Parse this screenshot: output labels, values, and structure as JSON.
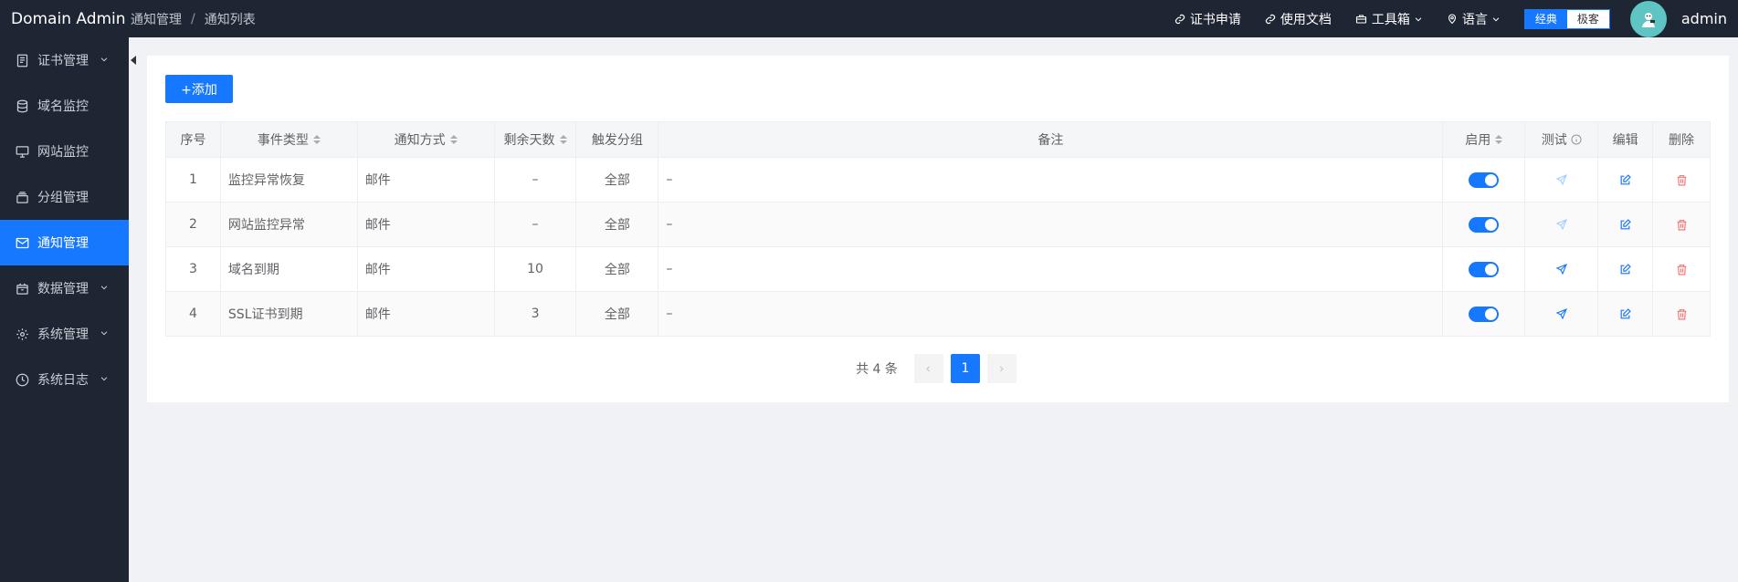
{
  "app": {
    "brand": "Domain Admin"
  },
  "breadcrumb": {
    "first": "通知管理",
    "separator": "/",
    "current": "通知列表"
  },
  "header": {
    "links": {
      "cert_apply": "证书申请",
      "docs": "使用文档",
      "toolbox": "工具箱",
      "language": "语言"
    },
    "mode": {
      "classic": "经典",
      "geek": "极客",
      "selected": "经典"
    },
    "user": {
      "name": "admin"
    }
  },
  "sidebar": {
    "items": [
      {
        "label": "证书管理",
        "icon": "document-icon",
        "expandable": true,
        "active": false
      },
      {
        "label": "域名监控",
        "icon": "database-icon",
        "expandable": false,
        "active": false
      },
      {
        "label": "网站监控",
        "icon": "monitor-icon",
        "expandable": false,
        "active": false
      },
      {
        "label": "分组管理",
        "icon": "stack-icon",
        "expandable": false,
        "active": false
      },
      {
        "label": "通知管理",
        "icon": "mail-icon",
        "expandable": false,
        "active": true
      },
      {
        "label": "数据管理",
        "icon": "box-icon",
        "expandable": true,
        "active": false
      },
      {
        "label": "系统管理",
        "icon": "gear-icon",
        "expandable": true,
        "active": false
      },
      {
        "label": "系统日志",
        "icon": "clock-icon",
        "expandable": true,
        "active": false
      }
    ]
  },
  "toolbar": {
    "add_label": "+添加"
  },
  "table": {
    "columns": {
      "index": "序号",
      "event_type": "事件类型",
      "notify_method": "通知方式",
      "days_left": "剩余天数",
      "trigger_group": "触发分组",
      "remark": "备注",
      "enabled": "启用",
      "test": "测试",
      "edit": "编辑",
      "delete": "删除"
    },
    "rows": [
      {
        "index": "1",
        "event_type": "监控异常恢复",
        "notify_method": "邮件",
        "days_left": "–",
        "trigger_group": "全部",
        "remark": "–",
        "enabled": true,
        "test_enabled": false
      },
      {
        "index": "2",
        "event_type": "网站监控异常",
        "notify_method": "邮件",
        "days_left": "–",
        "trigger_group": "全部",
        "remark": "–",
        "enabled": true,
        "test_enabled": false
      },
      {
        "index": "3",
        "event_type": "域名到期",
        "notify_method": "邮件",
        "days_left": "10",
        "trigger_group": "全部",
        "remark": "–",
        "enabled": true,
        "test_enabled": true
      },
      {
        "index": "4",
        "event_type": "SSL证书到期",
        "notify_method": "邮件",
        "days_left": "3",
        "trigger_group": "全部",
        "remark": "–",
        "enabled": true,
        "test_enabled": true
      }
    ]
  },
  "pagination": {
    "total_text": "共 4 条",
    "current_page": "1"
  },
  "colors": {
    "primary": "#1677ff",
    "sidebar_bg": "#1f2633",
    "delete": "#f56c6c"
  }
}
